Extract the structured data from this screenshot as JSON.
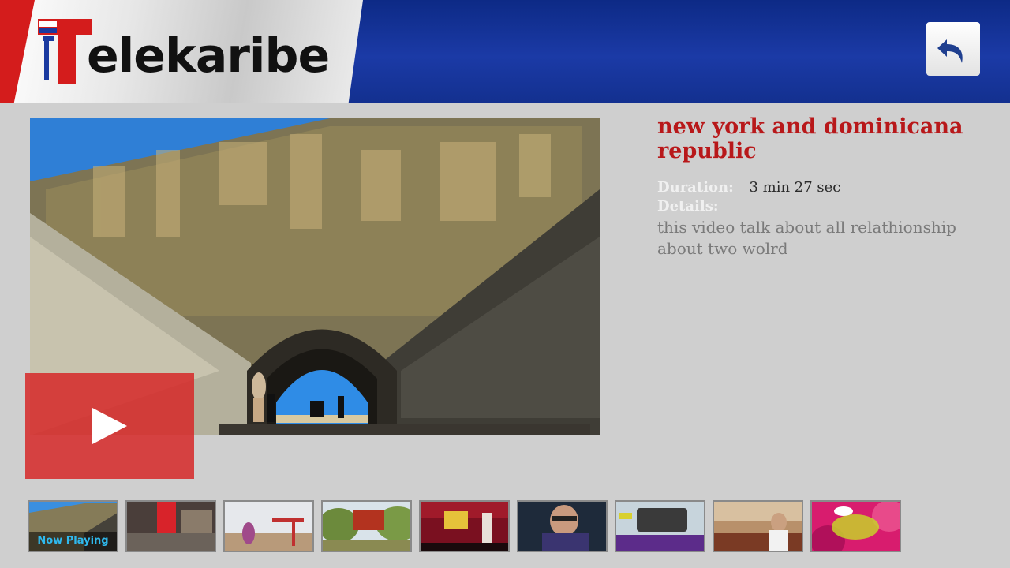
{
  "header": {
    "logo_text": "elekaribe",
    "back_button_icon": "undo-arrow-icon"
  },
  "video": {
    "title": "new york and dominicana republic",
    "duration_label": "Duration:",
    "duration_value": "3 min 27 sec",
    "details_label": "Details:",
    "details_text": "this video talk about all relathionship about two wolrd",
    "play_icon": "play-icon"
  },
  "thumbnails": {
    "now_playing_label": "Now Playing",
    "items": [
      {
        "id": 1,
        "now_playing": true
      },
      {
        "id": 2,
        "now_playing": false
      },
      {
        "id": 3,
        "now_playing": false
      },
      {
        "id": 4,
        "now_playing": false
      },
      {
        "id": 5,
        "now_playing": false
      },
      {
        "id": 6,
        "now_playing": false
      },
      {
        "id": 7,
        "now_playing": false
      },
      {
        "id": 8,
        "now_playing": false
      },
      {
        "id": 9,
        "now_playing": false
      }
    ]
  },
  "colors": {
    "header_blue": "#1b3aa6",
    "title_red": "#b8181a",
    "play_red": "#d62828",
    "now_playing_blue": "#2fb9ee",
    "background": "#cfcfcf"
  }
}
